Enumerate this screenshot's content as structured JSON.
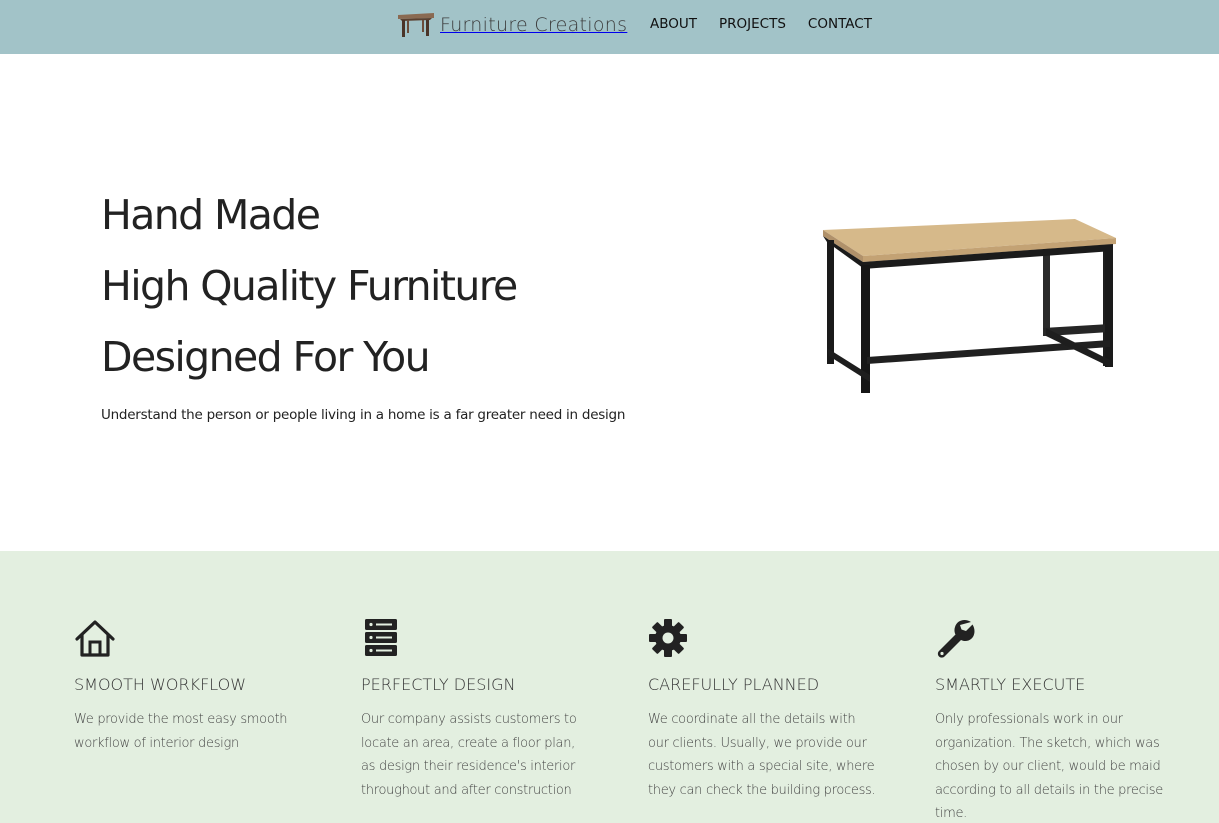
{
  "header": {
    "brand": {
      "name": "Furniture Creations",
      "logo_icon": "table-logo-icon"
    },
    "nav": [
      {
        "label": "ABOUT"
      },
      {
        "label": "PROJECTS"
      },
      {
        "label": "CONTACT"
      }
    ],
    "background_color": "#a2c3c8"
  },
  "hero": {
    "title_lines": [
      "Hand Made",
      "High Quality Furniture",
      "Designed For You"
    ],
    "subtitle": "Understand the person or people living in a home is a far greater need in design",
    "image_icon": "table-image"
  },
  "features": {
    "background_color": "#e3efe0",
    "items": [
      {
        "icon": "home-icon",
        "title": "SMOOTH WORKFLOW",
        "body": "We provide the most easy smooth workflow of interior design"
      },
      {
        "icon": "server-icon",
        "title": "PERFECTLY DESIGN",
        "body": "Our company assists customers to locate an area, create a floor plan, as design their residence's interior throughout and after construction"
      },
      {
        "icon": "gear-icon",
        "title": "CAREFULLY PLANNED",
        "body": "We coordinate all the details with our clients. Usually, we provide our customers with a special site, where they can check the building process."
      },
      {
        "icon": "wrench-icon",
        "title": "SMARTLY EXECUTE",
        "body": "Only professionals work in our organization. The sketch, which was chosen by our client, would be maid according to all details in the precise time."
      }
    ]
  }
}
